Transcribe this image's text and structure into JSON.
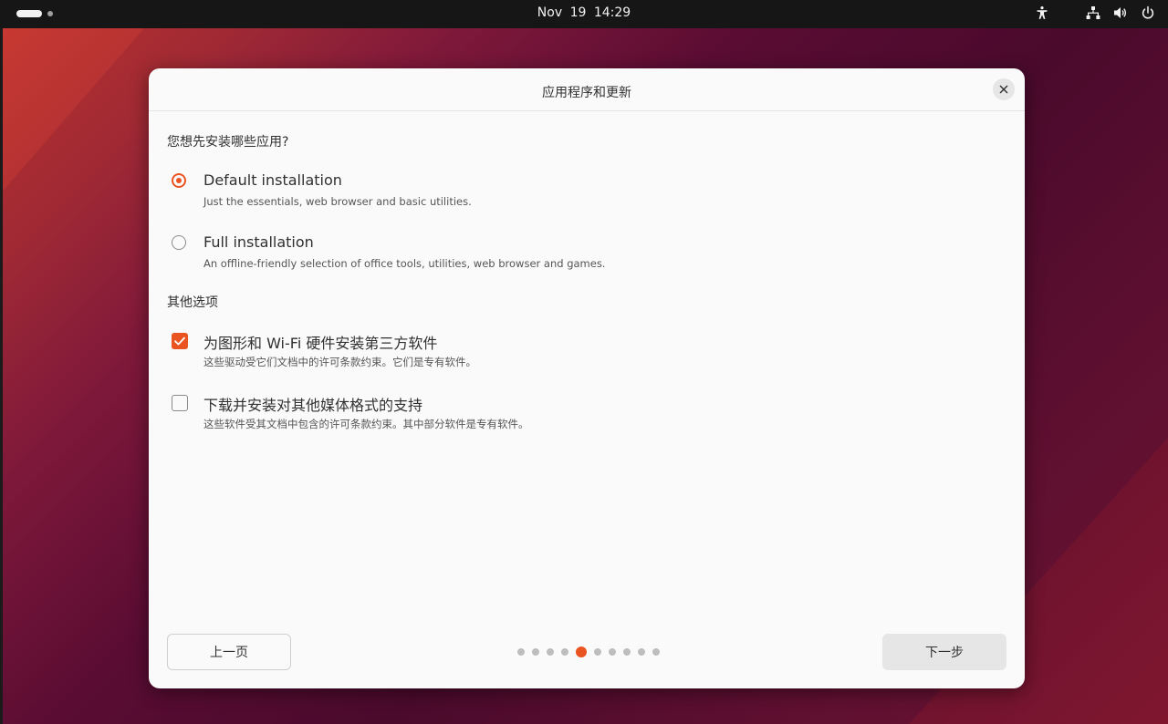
{
  "topbar": {
    "clock": "Nov 19  14:29",
    "icons": [
      "accessibility-icon",
      "network-icon",
      "volume-icon",
      "power-icon"
    ]
  },
  "dialog": {
    "title": "应用程序和更新",
    "question": "您想先安装哪些应用?",
    "install_options": [
      {
        "label": "Default installation",
        "description": "Just the essentials, web browser and basic utilities.",
        "selected": true
      },
      {
        "label": "Full installation",
        "description": "An offline-friendly selection of office tools, utilities, web browser and games.",
        "selected": false
      }
    ],
    "other_options_label": "其他选项",
    "other_options": [
      {
        "label": "为图形和 Wi-Fi 硬件安装第三方软件",
        "description": "这些驱动受它们文档中的许可条款约束。它们是专有软件。",
        "checked": true
      },
      {
        "label": "下载并安装对其他媒体格式的支持",
        "description": "这些软件受其文档中包含的许可条款约束。其中部分软件是专有软件。",
        "checked": false
      }
    ],
    "back_label": "上一页",
    "next_label": "下一步",
    "pager": {
      "total": 10,
      "current": 5
    }
  },
  "colors": {
    "accent": "#e95420",
    "topbar": "#161616",
    "dialog_bg": "#fafafa"
  }
}
